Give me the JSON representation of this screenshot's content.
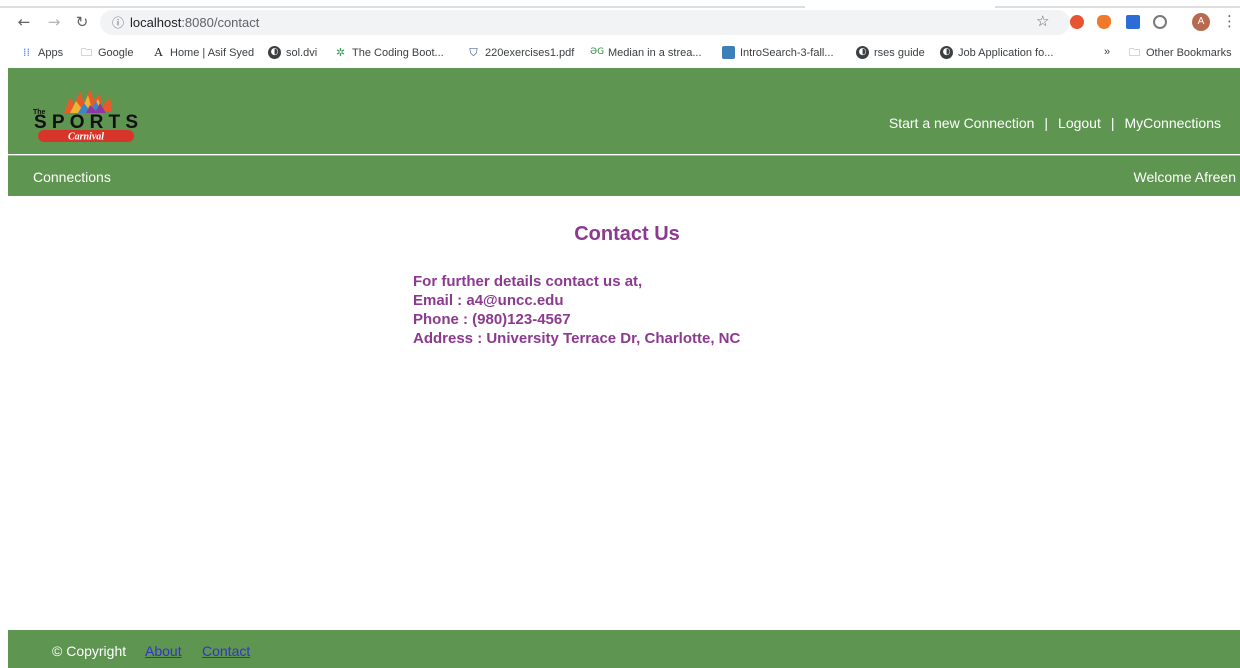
{
  "browser": {
    "url_host": "localhost",
    "url_path": ":8080/contact",
    "avatar_letter": "A",
    "bookmarks": [
      {
        "label": "Apps",
        "icon": "apps-grid-icon"
      },
      {
        "label": "Google",
        "icon": "folder-icon"
      },
      {
        "label": "Home | Asif Syed",
        "icon": "a-letter-icon"
      },
      {
        "label": "sol.dvi",
        "icon": "globe-icon"
      },
      {
        "label": "The Coding Boot...",
        "icon": "coding-bootcamp-icon"
      },
      {
        "label": "220exercises1.pdf",
        "icon": "shield-icon"
      },
      {
        "label": "Median in a strea...",
        "icon": "gfg-icon"
      },
      {
        "label": "IntroSearch-3-fall...",
        "icon": "site-icon"
      },
      {
        "label": "rses guide",
        "icon": "globe-icon"
      },
      {
        "label": "Job Application fo...",
        "icon": "globe-icon"
      }
    ],
    "more_bookmarks": "»",
    "other_bookmarks": "Other Bookmarks"
  },
  "header": {
    "logo_text_the": "The",
    "logo_text_main": "SPORTS",
    "logo_text_sub": "Carnival",
    "nav": {
      "start": "Start a new Connection",
      "logout": "Logout",
      "my": "MyConnections",
      "sep": "|"
    }
  },
  "subbar": {
    "left": "Connections",
    "right": "Welcome Afreen"
  },
  "main": {
    "title": "Contact Us",
    "lines": [
      "For further details contact us at,",
      "Email : a4@uncc.edu",
      "Phone : (980)123-4567",
      "Address : University Terrace Dr, Charlotte, NC"
    ]
  },
  "footer": {
    "copyright": "© Copyright",
    "about": "About",
    "contact": "Contact"
  },
  "colors": {
    "green": "#5e9550",
    "purple": "#8b3a8f",
    "link": "#3333cc"
  }
}
